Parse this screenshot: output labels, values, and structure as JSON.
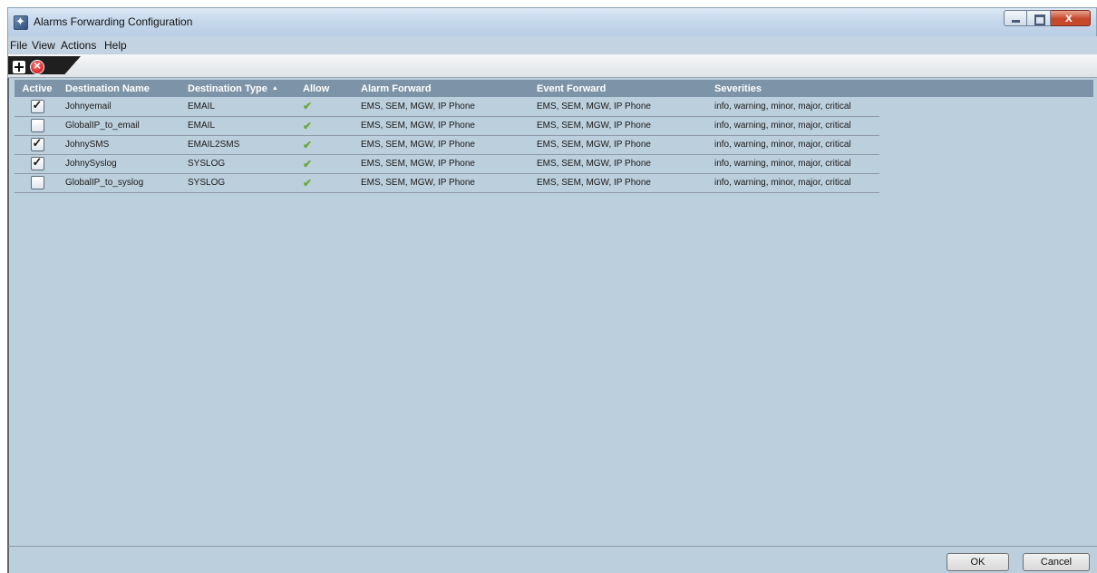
{
  "window": {
    "title": "Alarms Forwarding Configuration"
  },
  "menu": [
    "File",
    "View",
    "Actions",
    "Help"
  ],
  "toolbar": {
    "add_icon": "plus-icon",
    "delete_icon": "delete-icon"
  },
  "table": {
    "headers": {
      "active": "Active",
      "name": "Destination Name",
      "type": "Destination Type",
      "allow": "Allow",
      "alarm": "Alarm Forward",
      "event": "Event Forward",
      "severities": "Severities"
    },
    "sort_indicator": "▲",
    "allow_mark": "✔",
    "rows": [
      {
        "active": true,
        "name": "Johnyemail",
        "type": "EMAIL",
        "allow": true,
        "alarm": "EMS, SEM, MGW, IP Phone",
        "event": "EMS, SEM, MGW, IP Phone",
        "severities": "info, warning, minor, major, critical"
      },
      {
        "active": false,
        "name": "GlobalIP_to_email",
        "type": "EMAIL",
        "allow": true,
        "alarm": "EMS, SEM, MGW, IP Phone",
        "event": "EMS, SEM, MGW, IP Phone",
        "severities": "info, warning, minor, major, critical"
      },
      {
        "active": true,
        "name": "JohnySMS",
        "type": "EMAIL2SMS",
        "allow": true,
        "alarm": "EMS, SEM, MGW, IP Phone",
        "event": "EMS, SEM, MGW, IP Phone",
        "severities": "info, warning, minor, major, critical"
      },
      {
        "active": true,
        "name": "JohnySyslog",
        "type": "SYSLOG",
        "allow": true,
        "alarm": "EMS, SEM, MGW, IP Phone",
        "event": "EMS, SEM, MGW, IP Phone",
        "severities": "info, warning, minor, major, critical"
      },
      {
        "active": false,
        "name": "GlobalIP_to_syslog",
        "type": "SYSLOG",
        "allow": true,
        "alarm": "EMS, SEM, MGW, IP Phone",
        "event": "EMS, SEM, MGW, IP Phone",
        "severities": "info, warning, minor, major, critical"
      }
    ]
  },
  "buttons": {
    "ok": "OK",
    "cancel": "Cancel"
  },
  "colors": {
    "content_bg": "#bccfdc",
    "header_bg": "#7d94a8",
    "allow_green": "#6aa83a",
    "close_red": "#c7462a"
  }
}
